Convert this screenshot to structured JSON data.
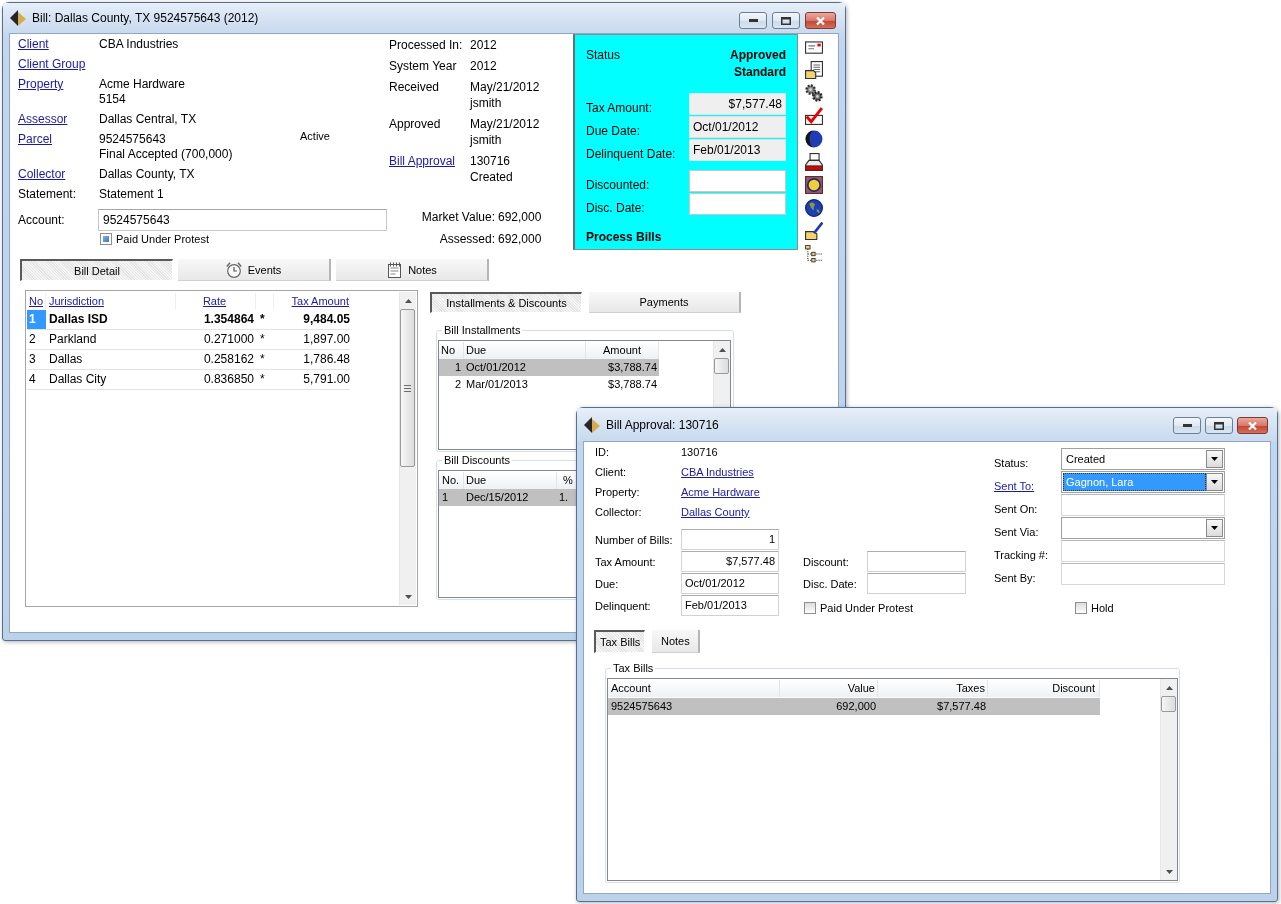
{
  "bill_window": {
    "title": "Bill: Dallas County, TX 9524575643 (2012)",
    "details": [
      {
        "label": "Client",
        "link": true,
        "lines": [
          "CBA Industries"
        ]
      },
      {
        "label": "Client Group",
        "link": true
      },
      {
        "label": "Property",
        "link": true,
        "lines": [
          "Acme Hardware",
          "5154"
        ]
      },
      {
        "label": "Assessor",
        "link": true,
        "lines": [
          "Dallas Central, TX"
        ]
      },
      {
        "label": "Parcel",
        "link": true,
        "lines": [
          "9524575643",
          "Final Accepted (700,000)"
        ],
        "note": "Active"
      },
      {
        "label": "Collector",
        "link": true,
        "lines": [
          "Dallas County, TX"
        ]
      },
      {
        "label": "Statement:",
        "link": false,
        "lines": [
          "Statement 1"
        ]
      }
    ],
    "account": {
      "label": "Account:",
      "value": "9524575643"
    },
    "paid_under_protest": {
      "label": "Paid Under Protest",
      "checked": true
    },
    "processing": [
      {
        "label": "Processed In:",
        "link": false,
        "lines": [
          "2012"
        ]
      },
      {
        "label": "System Year",
        "link": false,
        "lines": [
          "2012"
        ]
      },
      {
        "label": "Received",
        "link": false,
        "lines": [
          "May/21/2012",
          "jsmith"
        ]
      },
      {
        "label": "Approved",
        "link": false,
        "lines": [
          "May/21/2012",
          "jsmith"
        ]
      },
      {
        "label": "Bill Approval",
        "link": true,
        "lines": [
          "130716",
          "Created"
        ]
      }
    ],
    "valuation": [
      {
        "label": "Market Value:",
        "value": "692,000"
      },
      {
        "label": "Assessed:",
        "value": "692,000"
      }
    ],
    "status_panel": {
      "label": "Status",
      "status_lines": [
        "Approved",
        "Standard"
      ],
      "fields": [
        {
          "label": "Tax Amount:",
          "value": "$7,577.48",
          "kind": "amount"
        },
        {
          "label": "Due Date:",
          "value": "Oct/01/2012",
          "kind": "date"
        },
        {
          "label": "Delinquent Date:",
          "value": "Feb/01/2013",
          "kind": "date"
        },
        {
          "label": "Discounted:",
          "kind": "entry"
        },
        {
          "label": "Disc. Date:",
          "kind": "entry"
        }
      ],
      "action": "Process Bills"
    },
    "tabs": [
      {
        "label": "Bill Detail",
        "selected": true
      },
      {
        "label": "Events",
        "selected": false
      },
      {
        "label": "Notes",
        "selected": false
      }
    ],
    "jurisdictions": {
      "columns": [
        "No",
        "Jurisdiction",
        "Rate",
        "Tax Amount"
      ],
      "rows": [
        {
          "no": "1",
          "name": "Dallas ISD",
          "rate": "1.354864",
          "flag": "*",
          "amount": "9,484.05",
          "selected": true
        },
        {
          "no": "2",
          "name": "Parkland",
          "rate": "0.271000",
          "flag": "*",
          "amount": "1,897.00",
          "selected": false
        },
        {
          "no": "3",
          "name": "Dallas",
          "rate": "0.258162",
          "flag": "*",
          "amount": "1,786.48",
          "selected": false
        },
        {
          "no": "4",
          "name": "Dallas City",
          "rate": "0.836850",
          "flag": "*",
          "amount": "5,791.00",
          "selected": false
        }
      ]
    },
    "detail_tabs": [
      {
        "label": "Installments & Discounts",
        "selected": true
      },
      {
        "label": "Payments",
        "selected": false
      }
    ],
    "installments": {
      "title": "Bill Installments",
      "columns": [
        "No",
        "Due",
        "Amount"
      ],
      "rows": [
        {
          "cells": [
            "1",
            "Oct/01/2012",
            "$3,788.74"
          ],
          "selected": true
        },
        {
          "cells": [
            "2",
            "Mar/01/2013",
            "$3,788.74"
          ],
          "selected": false
        }
      ]
    },
    "discounts": {
      "title": "Bill Discounts",
      "columns": [
        "No.",
        "Due",
        "%"
      ],
      "rows": [
        {
          "cells": [
            "1",
            "Dec/15/2012",
            "1."
          ],
          "selected": true
        }
      ]
    }
  },
  "approval_window": {
    "title": "Bill Approval: 130716",
    "info": [
      {
        "label": "ID:",
        "value": "130716",
        "link": false
      },
      {
        "label": "Client:",
        "value": "CBA Industries",
        "link": true
      },
      {
        "label": "Property:",
        "value": "Acme Hardware",
        "link": true
      },
      {
        "label": "Collector:",
        "value": "Dallas County",
        "link": true
      }
    ],
    "amounts": [
      {
        "label": "Number of Bills:",
        "value": "1",
        "kind": "number"
      },
      {
        "label": "Tax Amount:",
        "value": "$7,577.48",
        "kind": "number"
      },
      {
        "label": "Due:",
        "value": "Oct/01/2012",
        "kind": "date"
      },
      {
        "label": "Delinquent:",
        "value": "Feb/01/2013",
        "kind": "date"
      }
    ],
    "discount_fields": [
      {
        "label": "Discount:"
      },
      {
        "label": "Disc. Date:"
      }
    ],
    "paid_under_protest": {
      "label": "Paid Under Protest",
      "checked": false
    },
    "routing": [
      {
        "label": "Status:",
        "link": false,
        "kind": "select",
        "value": "Created",
        "focused": false
      },
      {
        "label": "Sent To:",
        "link": true,
        "kind": "select",
        "value": "Gagnon, Lara",
        "focused": true
      },
      {
        "label": "Sent On:",
        "link": false,
        "kind": "text",
        "focused": false
      },
      {
        "label": "Sent Via:",
        "link": false,
        "kind": "select",
        "focused": false
      },
      {
        "label": "Tracking #:",
        "link": false,
        "kind": "text",
        "focused": false
      },
      {
        "label": "Sent By:",
        "link": false,
        "kind": "text",
        "focused": false
      }
    ],
    "hold": {
      "label": "Hold",
      "checked": false
    },
    "tabs": [
      {
        "label": "Tax Bills",
        "selected": true
      },
      {
        "label": "Notes",
        "selected": false
      }
    ],
    "tax_bills": {
      "title": "Tax Bills",
      "columns": [
        "Account",
        "Value",
        "Taxes",
        "Discount"
      ],
      "rows": [
        {
          "cells": [
            "9524575643",
            "692,000",
            "$7,577.48"
          ],
          "selected": true
        }
      ]
    }
  }
}
